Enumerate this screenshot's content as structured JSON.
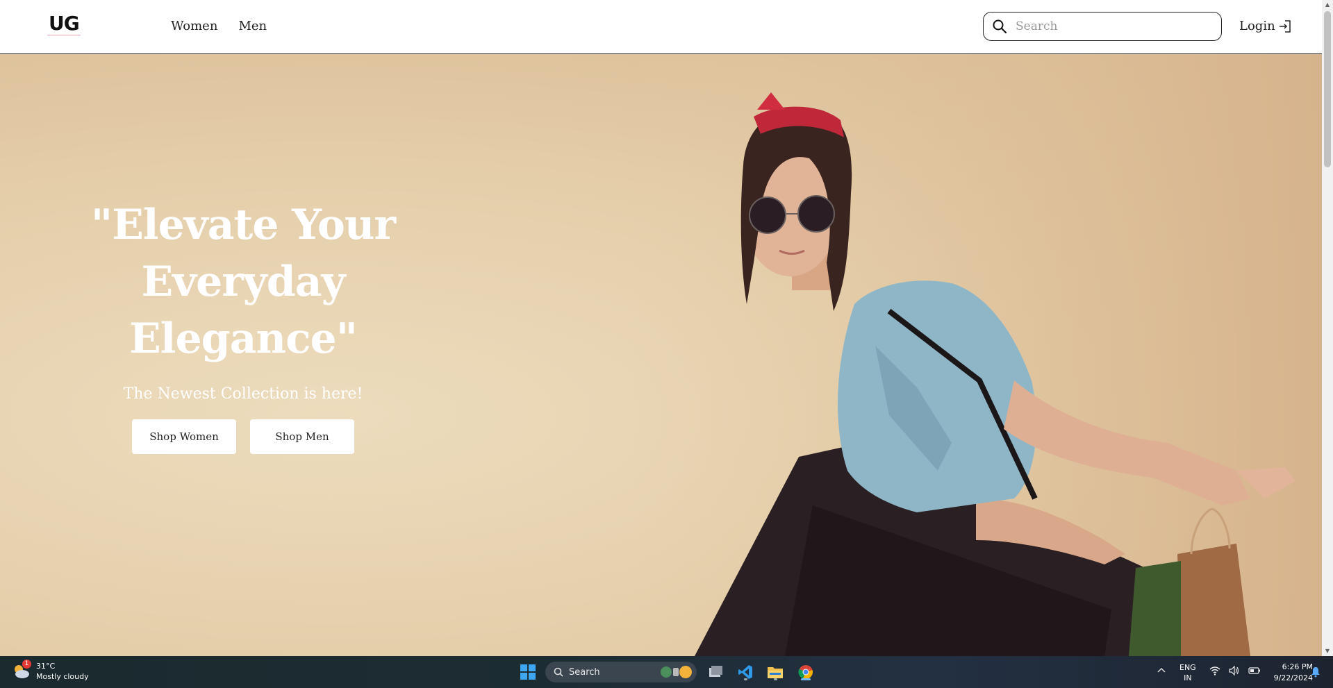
{
  "brand": {
    "logo": "UG"
  },
  "nav": {
    "links": [
      "Women",
      "Men"
    ]
  },
  "search": {
    "placeholder": "Search",
    "value": ""
  },
  "login": {
    "label": "Login"
  },
  "hero": {
    "title": "\"Elevate Your Everyday Elegance\"",
    "subtitle": "The Newest Collection is here!",
    "buttons": [
      "Shop Women",
      "Shop Men"
    ]
  },
  "taskbar": {
    "weather": {
      "temp": "31°C",
      "condition": "Mostly cloudy",
      "badge": "1"
    },
    "search_label": "Search",
    "language": {
      "line1": "ENG",
      "line2": "IN"
    },
    "clock": {
      "time": "6:26 PM",
      "date": "9/22/2024"
    }
  },
  "icons": {
    "search": "search-icon",
    "login": "login-icon",
    "start": "windows-start-icon",
    "task_view": "task-view-icon",
    "vscode": "vscode-icon",
    "explorer": "file-explorer-icon",
    "chrome": "chrome-icon",
    "wifi": "wifi-icon",
    "volume": "volume-icon",
    "battery": "battery-icon",
    "notification": "notification-bell-icon"
  },
  "colors": {
    "hero_bg": "#e5cfab",
    "nav_border": "#2a2a2a",
    "hero_text": "#ffffff"
  }
}
